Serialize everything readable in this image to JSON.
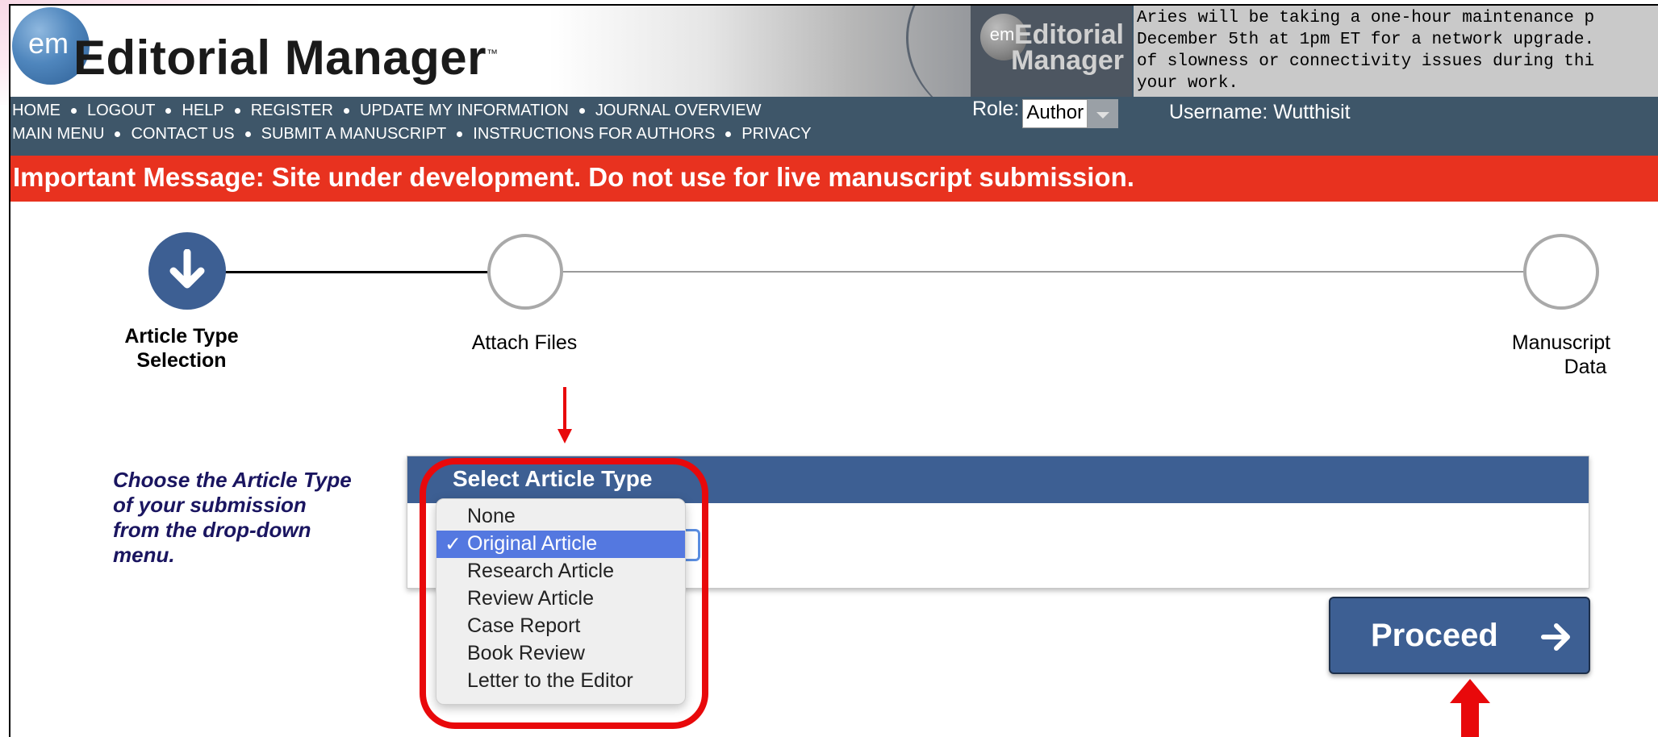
{
  "header": {
    "brand_prefix": "em",
    "brand_title": "Editorial Manager",
    "brand_tm": "™",
    "small_logo_prefix": "em",
    "small_logo_line1": "Editorial",
    "small_logo_line2": "Manager",
    "maintenance_text": "Aries will be taking a one-hour maintenance p\nDecember 5th at 1pm ET for a network upgrade.\nof slowness or connectivity issues during thi\nyour work."
  },
  "nav": {
    "row1": [
      "HOME",
      "LOGOUT",
      "HELP",
      "REGISTER",
      "UPDATE MY INFORMATION",
      "JOURNAL OVERVIEW"
    ],
    "row2": [
      "MAIN MENU",
      "CONTACT US",
      "SUBMIT A MANUSCRIPT",
      "INSTRUCTIONS FOR AUTHORS",
      "PRIVACY"
    ]
  },
  "role": {
    "label": "Role:",
    "value": "Author"
  },
  "username": "Username: Wutthisit",
  "important_message": "Important Message: Site under development. Do not use for live manuscript submission.",
  "steps": [
    {
      "line1": "Article Type",
      "line2": "Selection",
      "state": "current"
    },
    {
      "line1": "Attach Files",
      "line2": "",
      "state": "todo"
    },
    {
      "line1": "Manuscript",
      "line2": "Data",
      "state": "todo"
    }
  ],
  "instruction": [
    "Choose the Article Type",
    "of your submission",
    "from the drop-down",
    "menu."
  ],
  "panel_title": "Select Article Type",
  "dropdown": {
    "selected": "Original Article",
    "check": "✓",
    "options": [
      "None",
      "Original Article",
      "Research Article",
      "Review Article",
      "Case Report",
      "Book Review",
      "Letter to the Editor"
    ]
  },
  "proceed_label": "Proceed",
  "colors": {
    "accent": "#3d5f93",
    "alert": "#e8321f",
    "annotation": "#e8090b",
    "selection": "#5478e0"
  }
}
